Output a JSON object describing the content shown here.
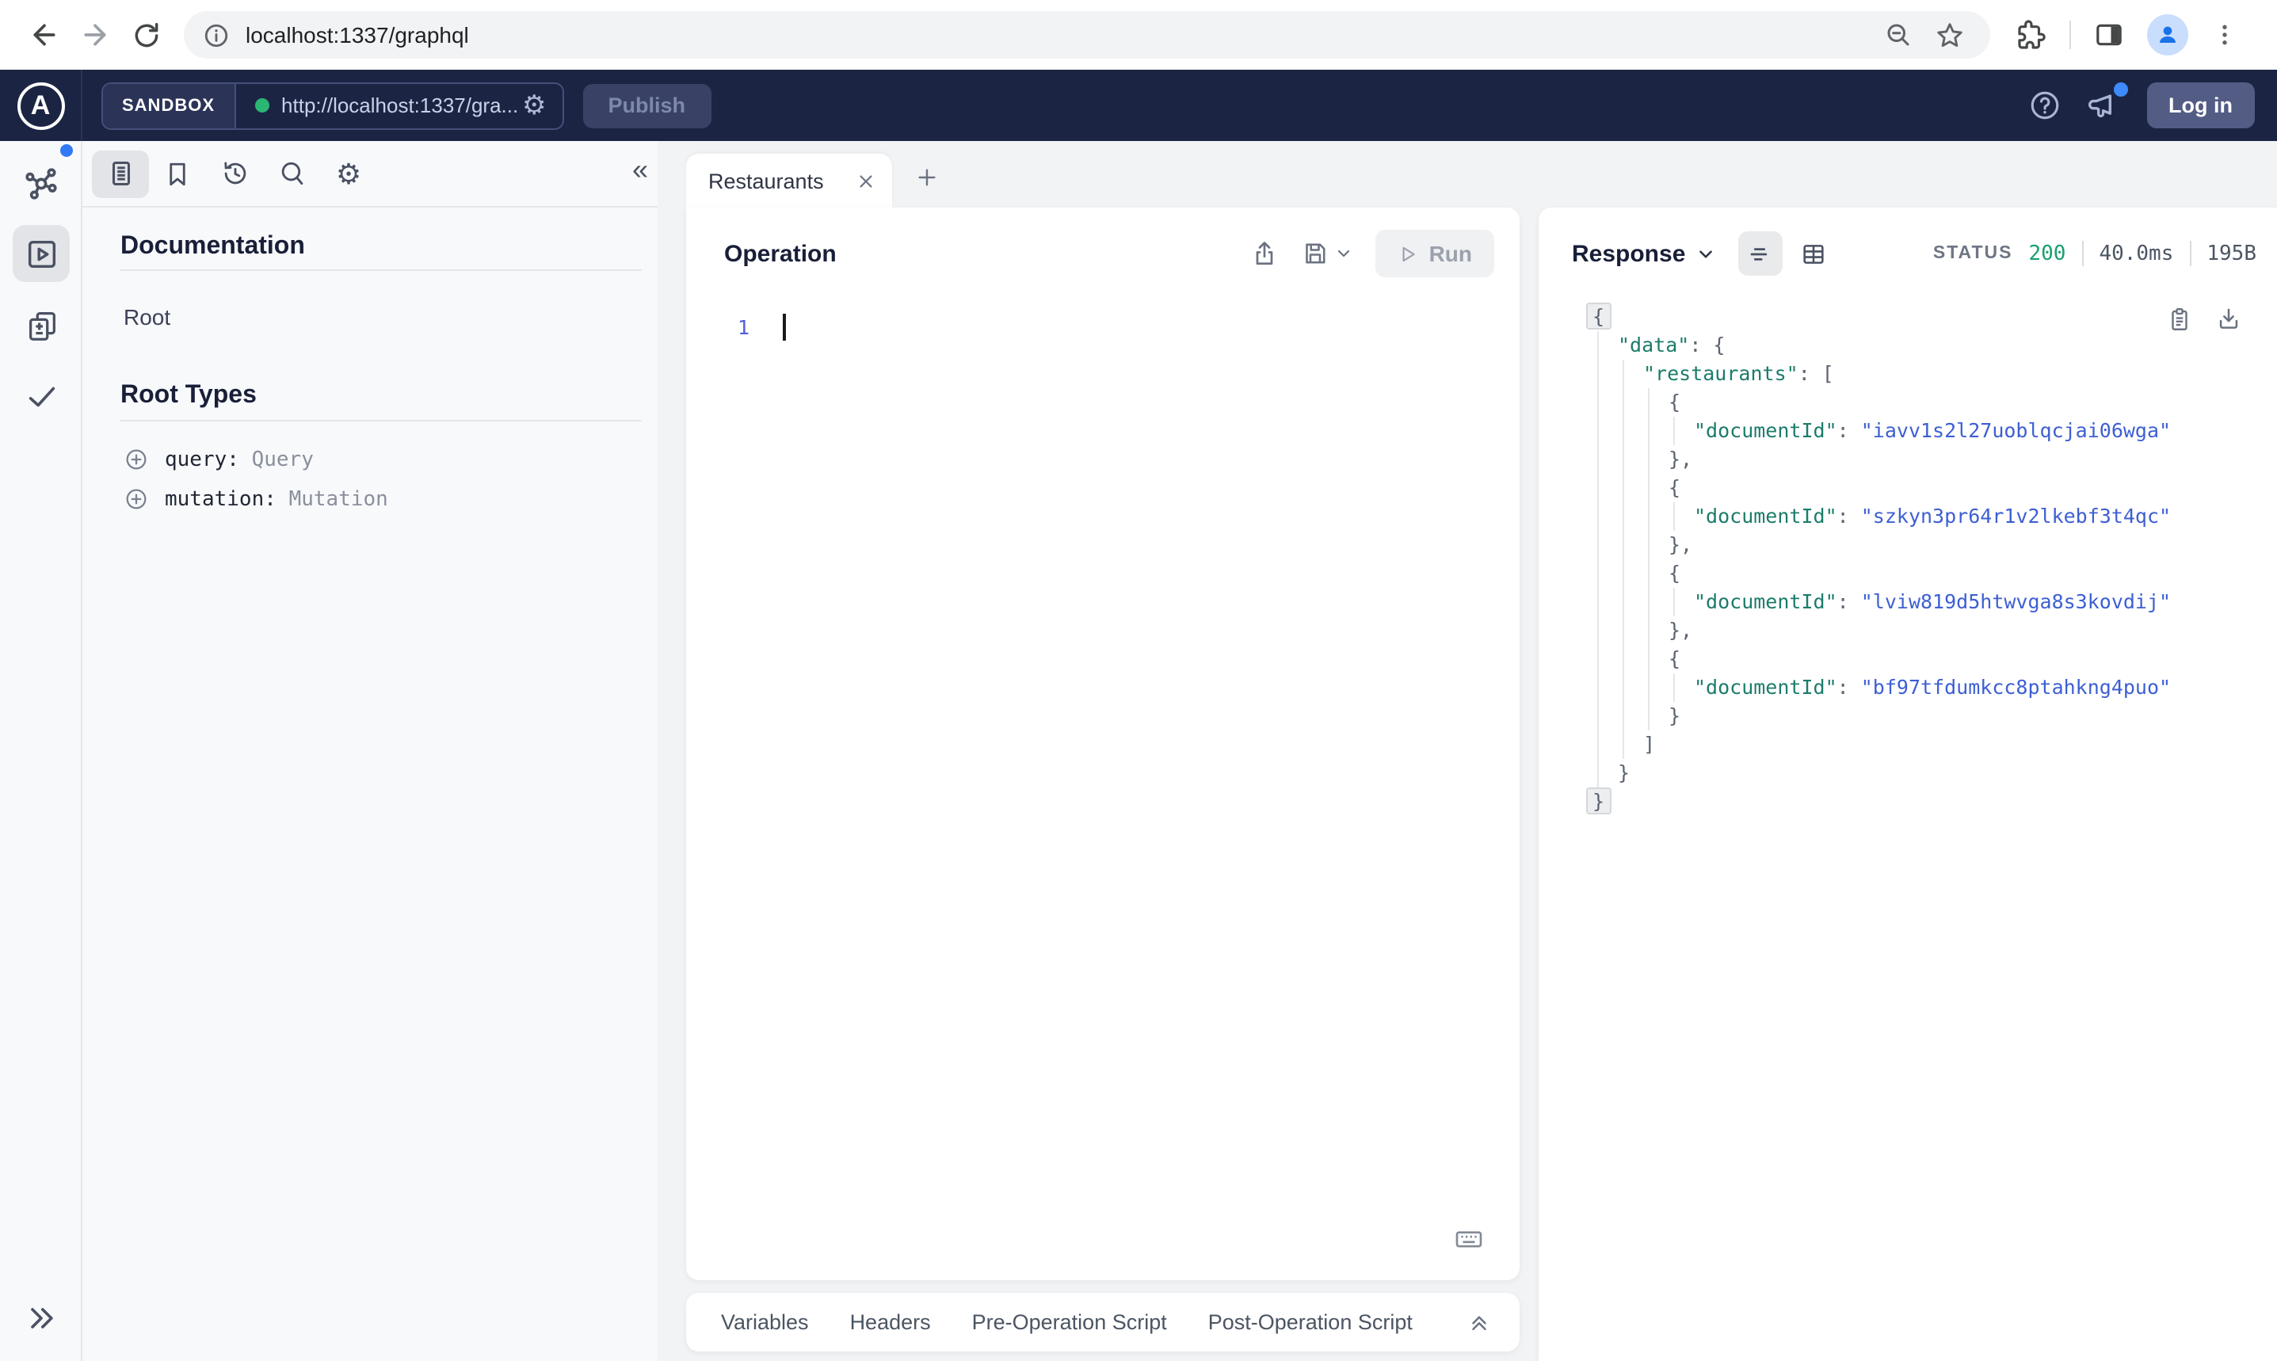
{
  "browser": {
    "url": "localhost:1337/graphql"
  },
  "apollo_header": {
    "logo_letter": "A",
    "env_label": "SANDBOX",
    "endpoint_url": "http://localhost:1337/gra...",
    "publish_label": "Publish",
    "login_label": "Log in"
  },
  "sidebar": {
    "documentation_title": "Documentation",
    "root_link": "Root",
    "root_types_title": "Root Types",
    "root_types": [
      {
        "keyword": "query:",
        "type": "Query"
      },
      {
        "keyword": "mutation:",
        "type": "Mutation"
      }
    ]
  },
  "tabs": {
    "active_label": "Restaurants"
  },
  "operation": {
    "title": "Operation",
    "run_label": "Run",
    "line_number": "1"
  },
  "response": {
    "title": "Response",
    "status_label": "STATUS",
    "status_code": "200",
    "time": "40.0ms",
    "size": "195B",
    "json_lines": [
      {
        "i": 0,
        "fold": true,
        "t": [
          {
            "c": "punc",
            "v": "{"
          }
        ]
      },
      {
        "i": 1,
        "t": [
          {
            "c": "key",
            "v": "\"data\""
          },
          {
            "c": "punc",
            "v": ": {"
          }
        ]
      },
      {
        "i": 2,
        "t": [
          {
            "c": "key",
            "v": "\"restaurants\""
          },
          {
            "c": "punc",
            "v": ": ["
          }
        ]
      },
      {
        "i": 3,
        "t": [
          {
            "c": "punc",
            "v": "{"
          }
        ]
      },
      {
        "i": 4,
        "t": [
          {
            "c": "key",
            "v": "\"documentId\""
          },
          {
            "c": "punc",
            "v": ": "
          },
          {
            "c": "str",
            "v": "\"iavv1s2l27uoblqcjai06wga\""
          }
        ]
      },
      {
        "i": 3,
        "t": [
          {
            "c": "punc",
            "v": "},"
          }
        ]
      },
      {
        "i": 3,
        "t": [
          {
            "c": "punc",
            "v": "{"
          }
        ]
      },
      {
        "i": 4,
        "t": [
          {
            "c": "key",
            "v": "\"documentId\""
          },
          {
            "c": "punc",
            "v": ": "
          },
          {
            "c": "str",
            "v": "\"szkyn3pr64r1v2lkebf3t4qc\""
          }
        ]
      },
      {
        "i": 3,
        "t": [
          {
            "c": "punc",
            "v": "},"
          }
        ]
      },
      {
        "i": 3,
        "t": [
          {
            "c": "punc",
            "v": "{"
          }
        ]
      },
      {
        "i": 4,
        "t": [
          {
            "c": "key",
            "v": "\"documentId\""
          },
          {
            "c": "punc",
            "v": ": "
          },
          {
            "c": "str",
            "v": "\"lviw819d5htwvga8s3kovdij\""
          }
        ]
      },
      {
        "i": 3,
        "t": [
          {
            "c": "punc",
            "v": "},"
          }
        ]
      },
      {
        "i": 3,
        "t": [
          {
            "c": "punc",
            "v": "{"
          }
        ]
      },
      {
        "i": 4,
        "t": [
          {
            "c": "key",
            "v": "\"documentId\""
          },
          {
            "c": "punc",
            "v": ": "
          },
          {
            "c": "str",
            "v": "\"bf97tfdumkcc8ptahkng4puo\""
          }
        ]
      },
      {
        "i": 3,
        "t": [
          {
            "c": "punc",
            "v": "}"
          }
        ]
      },
      {
        "i": 2,
        "t": [
          {
            "c": "punc",
            "v": "]"
          }
        ]
      },
      {
        "i": 1,
        "t": [
          {
            "c": "punc",
            "v": "}"
          }
        ]
      },
      {
        "i": 0,
        "fold": true,
        "t": [
          {
            "c": "punc",
            "v": "}"
          }
        ]
      }
    ]
  },
  "bottom_tabs": {
    "items": [
      "Variables",
      "Headers",
      "Pre-Operation Script",
      "Post-Operation Script"
    ]
  },
  "colors": {
    "header_navy": "#1c2444",
    "status_green": "#18a06d",
    "json_key_teal": "#1c7c6c",
    "json_string_blue": "#3d5fd3",
    "notification_blue": "#3179f6"
  }
}
